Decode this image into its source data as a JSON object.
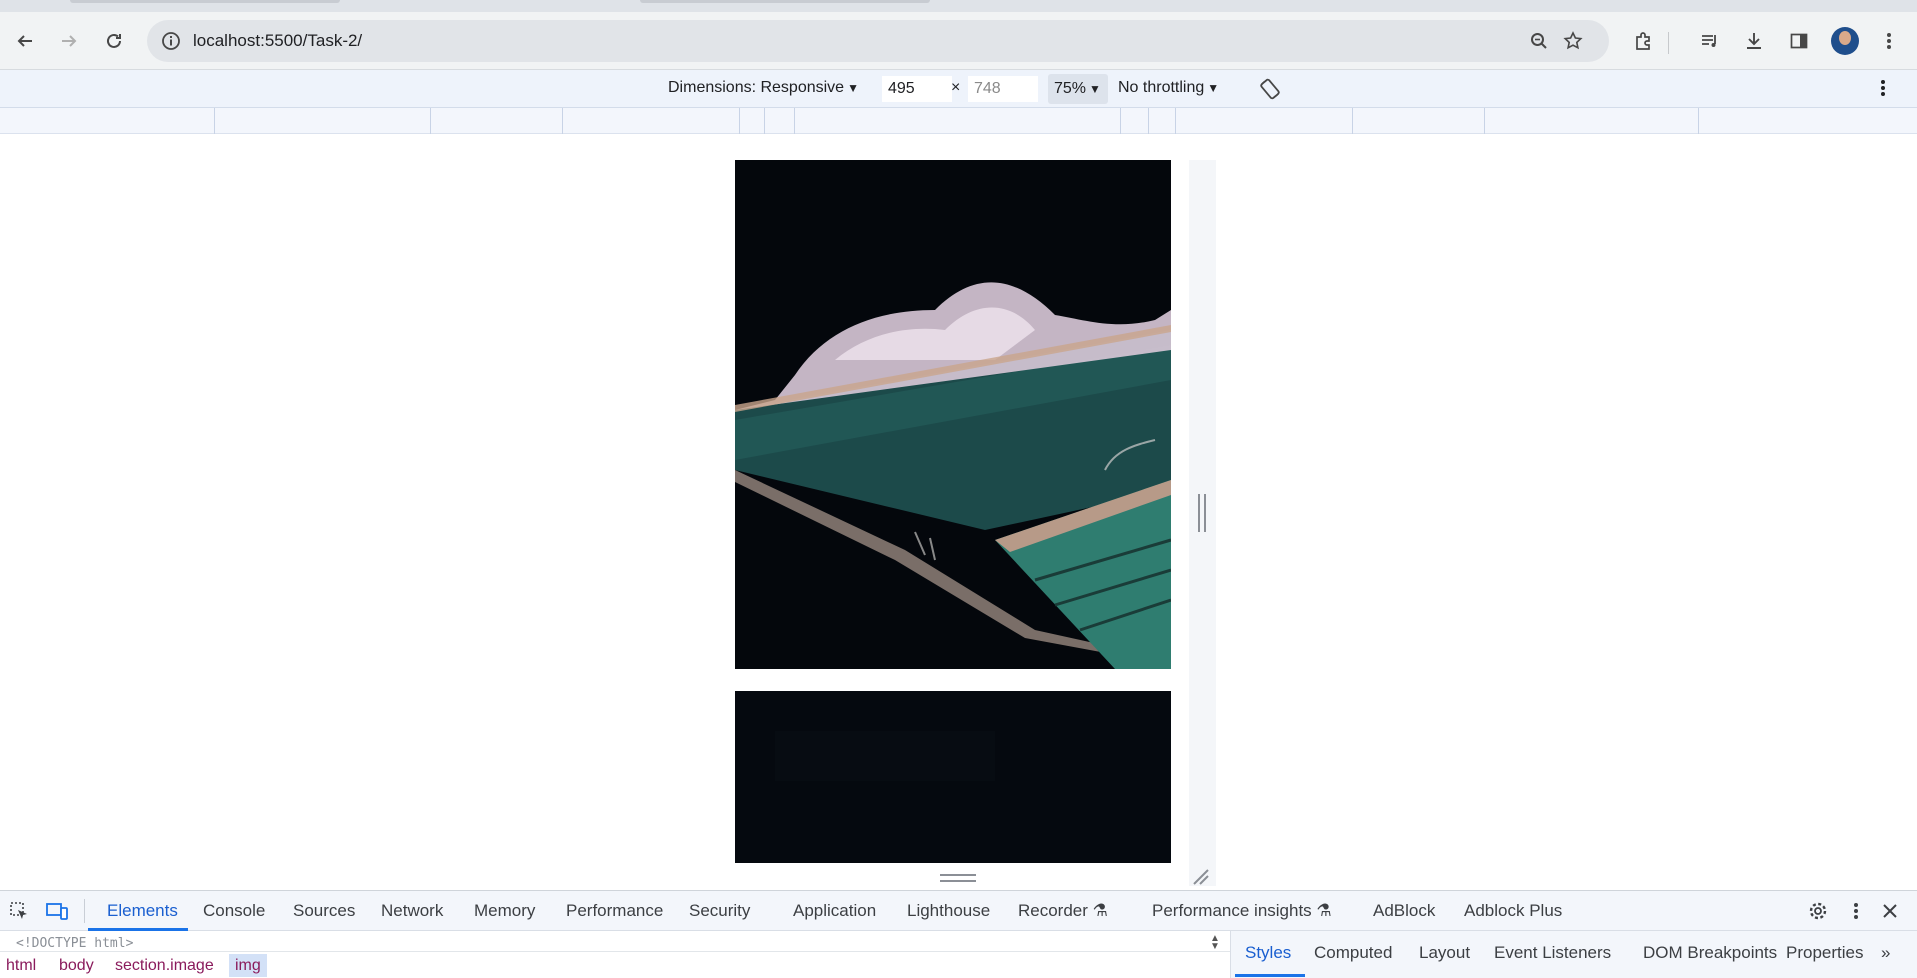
{
  "browser": {
    "url": "localhost:5500/Task-2/"
  },
  "device_toolbar": {
    "dimensions_label": "Dimensions: Responsive",
    "width_value": "495",
    "times": "×",
    "height_value": "748",
    "zoom": "75%",
    "throttling": "No throttling"
  },
  "page": {
    "images": [
      {
        "alt": "Night ocean pool with crashing wave",
        "colors": {
          "sky": "#04070c",
          "water": "#1c4a4a",
          "spray": "#d9c9d8",
          "pool": "#2f7d70",
          "deck": "#b79a88"
        }
      },
      {
        "alt": "Dark image",
        "colors": {
          "base": "#05090f"
        }
      }
    ]
  },
  "devtools": {
    "tabs": [
      "Elements",
      "Console",
      "Sources",
      "Network",
      "Memory",
      "Performance",
      "Security",
      "Application",
      "Lighthouse",
      "Recorder",
      "Performance insights",
      "AdBlock",
      "Adblock Plus"
    ],
    "active_tab": "Elements",
    "doctype_line": "<!DOCTYPE html>",
    "breadcrumbs": [
      "html",
      "body",
      "section.image",
      "img"
    ],
    "side_tabs": [
      "Styles",
      "Computed",
      "Layout",
      "Event Listeners",
      "DOM Breakpoints",
      "Properties"
    ],
    "active_side_tab": "Styles",
    "more": "»"
  }
}
